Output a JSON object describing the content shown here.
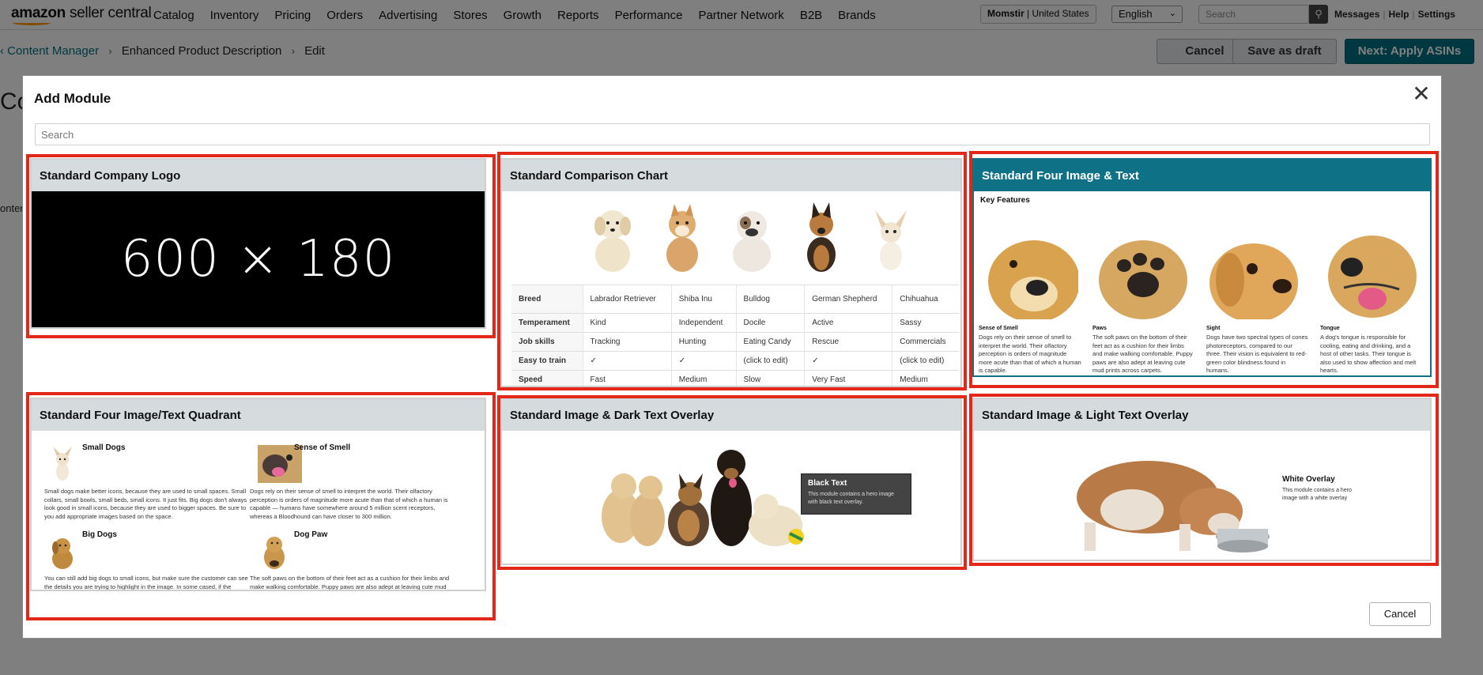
{
  "app": {
    "logo_amazon": "amazon",
    "logo_rest": "seller central"
  },
  "topnav": {
    "items": [
      "Catalog",
      "Inventory",
      "Pricing",
      "Orders",
      "Advertising",
      "Stores",
      "Growth",
      "Reports",
      "Performance",
      "Partner Network",
      "B2B",
      "Brands"
    ],
    "account_name": "Momstir",
    "account_region": "United States",
    "language": "English",
    "search_placeholder": "Search",
    "links": [
      "Messages",
      "Help",
      "Settings"
    ]
  },
  "breadcrumb": {
    "items": [
      "Content Manager",
      "Enhanced Product Description",
      "Edit"
    ]
  },
  "header_buttons": {
    "cancel": "Cancel",
    "save_draft": "Save as draft",
    "next": "Next: Apply ASINs"
  },
  "modal": {
    "title": "Add Module",
    "search_placeholder": "Search",
    "cancel": "Cancel",
    "modules": [
      {
        "title": "Standard Company Logo",
        "placeholder_text": "600 × 180"
      },
      {
        "title": "Standard Comparison Chart",
        "rows": [
          [
            "Breed",
            "Labrador Retriever",
            "Shiba Inu",
            "Bulldog",
            "German Shepherd",
            "Chihuahua"
          ],
          [
            "Temperament",
            "Kind",
            "Independent",
            "Docile",
            "Active",
            "Sassy"
          ],
          [
            "Job skills",
            "Tracking",
            "Hunting",
            "Eating Candy",
            "Rescue",
            "Commercials"
          ],
          [
            "Easy to train",
            "✓",
            "✓",
            "(click to edit)",
            "✓",
            "(click to edit)"
          ],
          [
            "Speed",
            "Fast",
            "Medium",
            "Slow",
            "Very Fast",
            "Medium"
          ]
        ]
      },
      {
        "title": "Standard Four Image & Text",
        "heading": "Key Features",
        "items": [
          {
            "caption": "Sense of Smell",
            "text": "Dogs rely on their sense of smell to interpret the world. Their olfactory perception is orders of magnitude more acute than that of which a human is capable."
          },
          {
            "caption": "Paws",
            "text": "The soft paws on the bottom of their feet act as a cushion for their limbs and make walking comfortable. Puppy paws are also adept at leaving cute mud prints across carpets."
          },
          {
            "caption": "Sight",
            "text": "Dogs have two spectral types of cones photoreceptors, compared to our three. Their vision is equivalent to red-green color blindness found in humans."
          },
          {
            "caption": "Tongue",
            "text": "A dog's tongue is responsible for cooling, eating and drinking, and a host of other tasks. Their tongue is also used to show affection and melt hearts."
          }
        ]
      },
      {
        "title": "Standard Four Image/Text Quadrant",
        "items": [
          {
            "caption": "Small Dogs",
            "text": "Small dogs make better icons, because they are used to small spaces. Small collars, small bowls, small beds, small icons. It just fits. Big dogs don't always look good in small icons, because they are used to bigger spaces. Be sure to you add appropriate images based on the space."
          },
          {
            "caption": "Sense of Smell",
            "text": "Dogs rely on their sense of smell to interpret the world. Their olfactory perception is orders of magnitude more acute than that of which a human is capable — humans have somewhere around 5 million scent receptors, whereas a Bloodhound can have closer to 300 million."
          },
          {
            "caption": "Big Dogs",
            "text": "You can still add big dogs to small icons, but make sure the customer can see the details you are trying to highlight in the image. In some cased, if the"
          },
          {
            "caption": "Dog Paw",
            "text": "The soft paws on the bottom of their feet act as a cushion for their limbs and make walking comfortable. Puppy paws are also adept at leaving cute mud prints across"
          }
        ]
      },
      {
        "title": "Standard Image & Dark Text Overlay",
        "overlay_title": "Black Text",
        "overlay_text": "This module contains a hero image with black text overlay."
      },
      {
        "title": "Standard Image & Light Text Overlay",
        "overlay_title": "White Overlay",
        "overlay_text": "This module contains a hero image with a white overlay"
      }
    ]
  },
  "background": {
    "side_heading_fragment": "Cor",
    "side_label_fragment": "onten"
  },
  "colors": {
    "accent": "#007185",
    "selected_header": "#0f7185",
    "highlight_border": "#e3281a"
  }
}
